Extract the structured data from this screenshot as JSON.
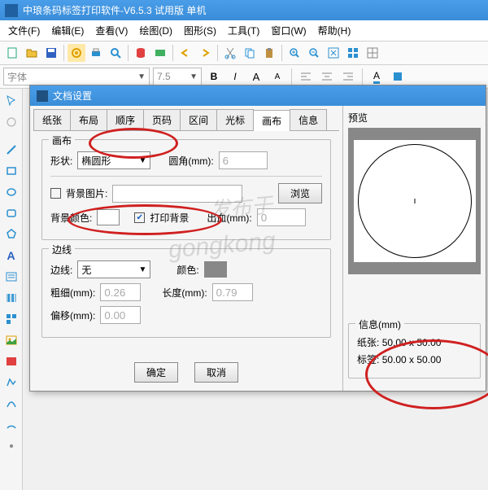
{
  "app": {
    "title": "中琅条码标签打印软件-V6.5.3 试用版 单机"
  },
  "menu": [
    "文件(F)",
    "编辑(E)",
    "查看(V)",
    "绘图(D)",
    "图形(S)",
    "工具(T)",
    "窗口(W)",
    "帮助(H)"
  ],
  "fontbar": {
    "font_placeholder": "字体",
    "size_value": "7.5"
  },
  "dialog": {
    "title": "文档设置",
    "tabs": [
      "纸张",
      "布局",
      "顺序",
      "页码",
      "区间",
      "光标",
      "画布",
      "信息"
    ],
    "active_tab": "画布",
    "canvas": {
      "legend": "画布",
      "shape_label": "形状:",
      "shape_value": "椭圆形",
      "radius_label": "圆角(mm):",
      "radius_value": "6",
      "bgimg_label": "背景图片:",
      "browse": "浏览",
      "bgcolor_label": "背景颜色:",
      "printbg_label": "打印背景",
      "bleed_label": "出血(mm):",
      "bleed_value": "0"
    },
    "border": {
      "legend": "边线",
      "line_label": "边线:",
      "line_value": "无",
      "color_label": "颜色:",
      "thick_label": "粗细(mm):",
      "thick_value": "0.26",
      "len_label": "长度(mm):",
      "len_value": "0.79",
      "offset_label": "偏移(mm):",
      "offset_value": "0.00"
    },
    "ok": "确定",
    "cancel": "取消",
    "preview_label": "预览",
    "info": {
      "legend": "信息(mm)",
      "paper_label": "纸张:",
      "paper_value": "50.00 x 50.00",
      "label_label": "标签:",
      "label_value": "50.00 x 50.00"
    }
  },
  "watermarks": {
    "wm1": "发布于",
    "wm2": "gongkong"
  }
}
